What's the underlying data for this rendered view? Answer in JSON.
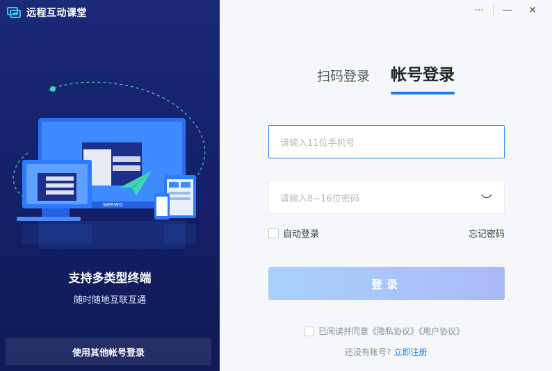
{
  "app": {
    "title": "远程互动课堂"
  },
  "left": {
    "slogan": "支持多类型终端",
    "sub_slogan": "随时随地互联互通",
    "other_login_label": "使用其他帐号登录",
    "illustration_brand": "seewo"
  },
  "window_controls": {
    "more": "···",
    "minimize": "—",
    "close": "✕"
  },
  "tabs": [
    {
      "label": "扫码登录",
      "active": false
    },
    {
      "label": "帐号登录",
      "active": true
    }
  ],
  "form": {
    "phone_placeholder": "请输入11位手机号",
    "password_placeholder": "请输入8~16位密码",
    "auto_login_label": "自动登录",
    "forgot_label": "忘记密码",
    "login_button_label": "登录"
  },
  "agreement": {
    "text": "已阅读并同意《隐私协议》《用户协议》"
  },
  "register": {
    "prompt": "还没有帐号?",
    "link_label": "立即注册"
  },
  "colors": {
    "accent": "#1a7ff0",
    "left_bg": "#14206a",
    "button_gradient_start": "#a9d1fb",
    "button_gradient_end": "#aab9f8"
  }
}
